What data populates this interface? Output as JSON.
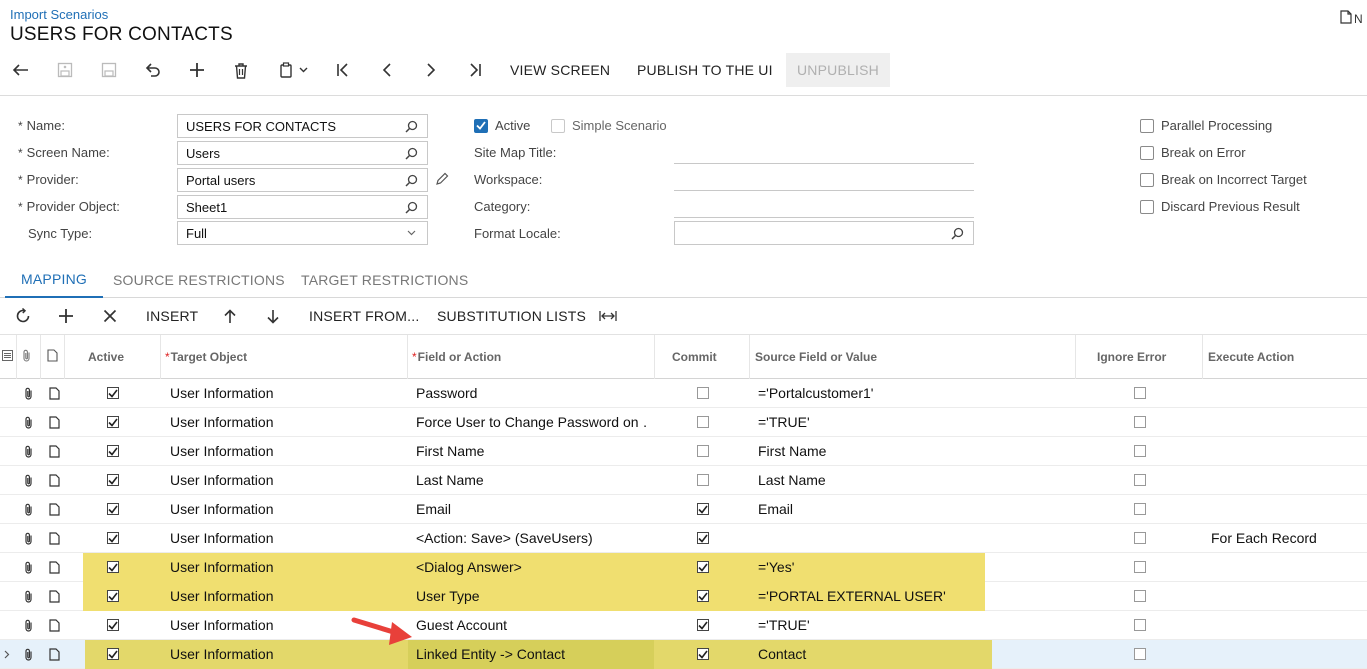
{
  "header": {
    "breadcrumb": "Import Scenarios",
    "title": "USERS FOR CONTACTS",
    "corner_text": "N"
  },
  "toolbar": {
    "back_icon": "undo-arrow-icon",
    "view_screen": "VIEW SCREEN",
    "publish": "PUBLISH TO THE UI",
    "unpublish": "UNPUBLISH"
  },
  "form": {
    "name_label": "Name:",
    "name_value": "USERS FOR CONTACTS",
    "screen_label": "Screen Name:",
    "screen_value": "Users",
    "provider_label": "Provider:",
    "provider_value": "Portal users",
    "provider_object_label": "Provider Object:",
    "provider_object_value": "Sheet1",
    "sync_label": "Sync Type:",
    "sync_value": "Full",
    "active_label": "Active",
    "active_checked": true,
    "simple_label": "Simple Scenario",
    "simple_checked": false,
    "sitemap_label": "Site Map Title:",
    "workspace_label": "Workspace:",
    "category_label": "Category:",
    "locale_label": "Format Locale:",
    "locale_value": "",
    "parallel_label": "Parallel Processing",
    "break_error_label": "Break on Error",
    "break_target_label": "Break on Incorrect Target",
    "discard_label": "Discard Previous Result"
  },
  "tabs": {
    "mapping": "MAPPING",
    "source": "SOURCE RESTRICTIONS",
    "target": "TARGET RESTRICTIONS"
  },
  "grid_toolbar": {
    "insert": "INSERT",
    "insert_from": "INSERT FROM...",
    "substitution": "SUBSTITUTION LISTS"
  },
  "grid": {
    "columns": {
      "active": "Active",
      "target": "Target Object",
      "field": "Field or Action",
      "commit": "Commit",
      "source": "Source Field or Value",
      "ignore": "Ignore Error",
      "execute": "Execute Action"
    },
    "rows": [
      {
        "active": true,
        "target": "User Information",
        "field": "Password",
        "commit": false,
        "source": "='Portalcustomer1'",
        "ignore": false,
        "execute": "",
        "highlight": ""
      },
      {
        "active": true,
        "target": "User Information",
        "field": "Force User to Change Password on …",
        "commit": false,
        "source": "='TRUE'",
        "ignore": false,
        "execute": "",
        "highlight": ""
      },
      {
        "active": true,
        "target": "User Information",
        "field": "First Name",
        "commit": false,
        "source": "First Name",
        "ignore": false,
        "execute": "",
        "highlight": ""
      },
      {
        "active": true,
        "target": "User Information",
        "field": "Last Name",
        "commit": false,
        "source": "Last Name",
        "ignore": false,
        "execute": "",
        "highlight": ""
      },
      {
        "active": true,
        "target": "User Information",
        "field": "Email",
        "commit": true,
        "source": "Email",
        "ignore": false,
        "execute": "",
        "highlight": ""
      },
      {
        "active": true,
        "target": "User Information",
        "field": "<Action: Save> (SaveUsers)",
        "commit": true,
        "source": "",
        "ignore": false,
        "execute": "For Each Record",
        "highlight": ""
      },
      {
        "active": true,
        "target": "User Information",
        "field": "<Dialog Answer>",
        "commit": true,
        "source": "='Yes'",
        "ignore": false,
        "execute": "",
        "highlight": "yellow"
      },
      {
        "active": true,
        "target": "User Information",
        "field": "User Type",
        "commit": true,
        "source": "='PORTAL EXTERNAL USER'",
        "ignore": false,
        "execute": "",
        "highlight": "yellow"
      },
      {
        "active": true,
        "target": "User Information",
        "field": "Guest Account",
        "commit": true,
        "source": "='TRUE'",
        "ignore": false,
        "execute": "",
        "highlight": ""
      },
      {
        "active": true,
        "target": "User Information",
        "field": "Linked Entity -> Contact",
        "commit": true,
        "source": "Contact",
        "ignore": false,
        "execute": "",
        "highlight": "yellow-selected"
      }
    ]
  },
  "annotation": {
    "arrow_color": "#e8403a",
    "highlight_color": "#f0df70"
  }
}
